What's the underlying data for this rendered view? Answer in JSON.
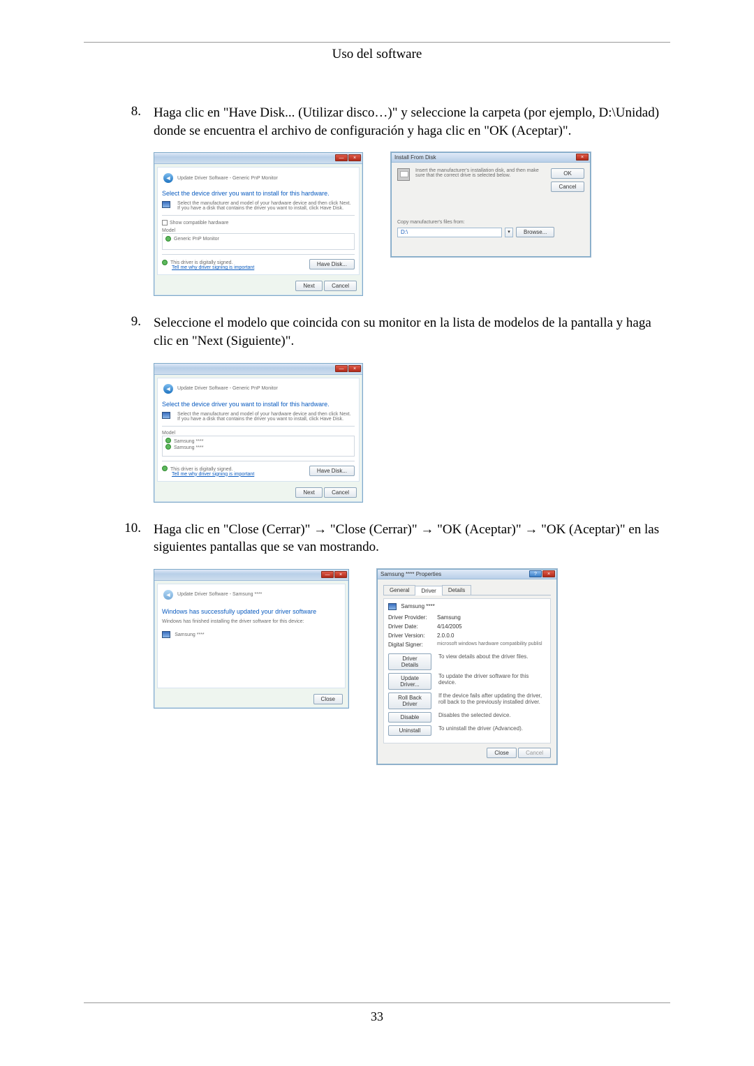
{
  "header": {
    "title": "Uso del software"
  },
  "steps": {
    "s8": {
      "num": "8.",
      "text": "Haga clic en \"Have Disk... (Utilizar disco…)\" y seleccione la carpeta (por ejemplo, D:\\Unidad) donde se encuentra el archivo de configuración y haga clic en \"OK (Aceptar)\"."
    },
    "s9": {
      "num": "9.",
      "text": "Seleccione el modelo que coincida con su monitor en la lista de modelos de la pantalla y haga clic en \"Next (Siguiente)\"."
    },
    "s10": {
      "num": "10.",
      "text": "Haga clic en \"Close (Cerrar)\" → \"Close (Cerrar)\" → \"OK (Aceptar)\" → \"OK (Aceptar)\" en las siguientes pantallas que se van mostrando."
    }
  },
  "win_update1": {
    "crumb": "Update Driver Software - Generic PnP Monitor",
    "heading": "Select the device driver you want to install for this hardware.",
    "instr": "Select the manufacturer and model of your hardware device and then click Next. If you have a disk that contains the driver you want to install, click Have Disk.",
    "show_compat": "Show compatible hardware",
    "model_lbl": "Model",
    "model_item": "Generic PnP Monitor",
    "signed": "This driver is digitally signed.",
    "tell_link": "Tell me why driver signing is important",
    "have_disk": "Have Disk...",
    "next": "Next",
    "cancel": "Cancel"
  },
  "dlg_disk": {
    "title": "Install From Disk",
    "instr": "Insert the manufacturer's installation disk, and then make sure that the correct drive is selected below.",
    "ok": "OK",
    "cancel": "Cancel",
    "copy_lbl": "Copy manufacturer's files from:",
    "path": "D:\\",
    "browse": "Browse..."
  },
  "win_update2": {
    "crumb": "Update Driver Software - Generic PnP Monitor",
    "heading": "Select the device driver you want to install for this hardware.",
    "instr": "Select the manufacturer and model of your hardware device and then click Next. If you have a disk that contains the driver you want to install, click Have Disk.",
    "model_lbl": "Model",
    "model_item1": "Samsung ****",
    "model_item2": "Samsung ****",
    "signed": "This driver is digitally signed.",
    "tell_link": "Tell me why driver signing is important",
    "have_disk": "Have Disk...",
    "next": "Next",
    "cancel": "Cancel"
  },
  "win_done": {
    "crumb": "Update Driver Software - Samsung ****",
    "heading": "Windows has successfully updated your driver software",
    "sub": "Windows has finished installing the driver software for this device:",
    "device": "Samsung ****",
    "close": "Close"
  },
  "dlg_props": {
    "title": "Samsung **** Properties",
    "tab_general": "General",
    "tab_driver": "Driver",
    "tab_details": "Details",
    "device": "Samsung ****",
    "provider_lbl": "Driver Provider:",
    "provider_val": "Samsung",
    "date_lbl": "Driver Date:",
    "date_val": "4/14/2005",
    "version_lbl": "Driver Version:",
    "version_val": "2.0.0.0",
    "signer_lbl": "Digital Signer:",
    "signer_val": "microsoft windows hardware compatibility publisl",
    "btn_details": "Driver Details",
    "btn_details_desc": "To view details about the driver files.",
    "btn_update": "Update Driver...",
    "btn_update_desc": "To update the driver software for this device.",
    "btn_rollback": "Roll Back Driver",
    "btn_rollback_desc": "If the device fails after updating the driver, roll back to the previously installed driver.",
    "btn_disable": "Disable",
    "btn_disable_desc": "Disables the selected device.",
    "btn_uninstall": "Uninstall",
    "btn_uninstall_desc": "To uninstall the driver (Advanced).",
    "close": "Close",
    "cancel": "Cancel"
  },
  "footer": {
    "pagenum": "33"
  }
}
